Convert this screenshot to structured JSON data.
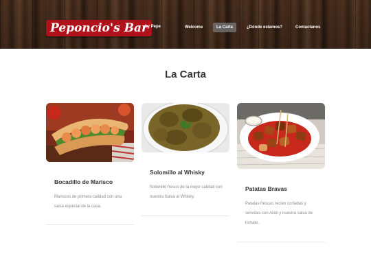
{
  "brand": {
    "name": "Peponcio's Bar",
    "tagline": "by Pepe",
    "logo_color": "#b0121b"
  },
  "nav": {
    "items": [
      {
        "label": "Welcome",
        "active": false
      },
      {
        "label": "La Carta",
        "active": true
      },
      {
        "label": "¿Dónde estamos?",
        "active": false
      },
      {
        "label": "Contactanos",
        "active": false
      }
    ]
  },
  "main": {
    "title": "La Carta",
    "cards": [
      {
        "title": "Bocadillo de Marisco",
        "description": "Mariscos de primera calidad con una salsa especial de la casa.",
        "image": "seafood-sandwich-image"
      },
      {
        "title": "Solomillo al Whisky",
        "description": "Solomillo fresco de la mejor calidad con nuestra Salsa al Whisky.",
        "image": "whisky-sirloin-image"
      },
      {
        "title": "Patatas Bravas",
        "description": "Patatas frescas recien cortadas y servidas con Alioli y nuestra salsa de tomate.",
        "image": "patatas-bravas-image"
      }
    ]
  }
}
